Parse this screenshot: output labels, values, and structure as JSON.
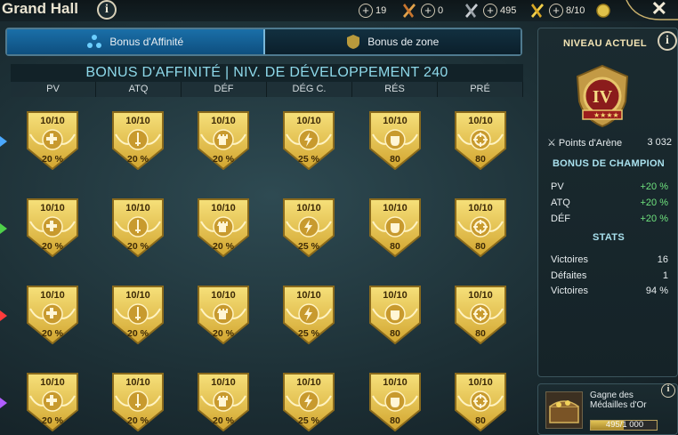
{
  "header": {
    "title": "Grand Hall",
    "resources": [
      {
        "value": "19",
        "icon": "arena-token-icon"
      },
      {
        "value": "0",
        "icon": "sword-token-icon"
      },
      {
        "value": "495",
        "icon": "gold-medal-icon"
      },
      {
        "value": "8/10",
        "icon": "gold-coin-icon"
      }
    ]
  },
  "tabs": [
    {
      "label": "Bonus d'Affinité",
      "active": true
    },
    {
      "label": "Bonus de zone",
      "active": false
    }
  ],
  "main": {
    "heading": "BONUS D'AFFINITÉ | NIV. DE DÉVELOPPEMENT 240",
    "columns": [
      "PV",
      "ATQ",
      "DÉF",
      "DÉG C.",
      "RÉS",
      "PRÉ"
    ],
    "affinities": [
      "magic",
      "force",
      "spirit",
      "void"
    ],
    "affinity_colors": [
      "#4aa8ff",
      "#4fd14a",
      "#ff3b3b",
      "#b05cff"
    ],
    "level_text": "10/10",
    "values": [
      "20 %",
      "20 %",
      "20 %",
      "25 %",
      "80",
      "80"
    ],
    "icons": [
      "health-cross-icon",
      "sword-icon",
      "tower-icon",
      "lightning-icon",
      "fist-icon",
      "crosshair-icon"
    ]
  },
  "panel": {
    "title": "NIVEAU ACTUEL",
    "rank": "IV",
    "points_label": "Points d'Arène",
    "points_value": "3 032",
    "champion_bonus_title": "BONUS DE CHAMPION",
    "champion_bonus": [
      {
        "label": "PV",
        "value": "+20 %"
      },
      {
        "label": "ATQ",
        "value": "+20 %"
      },
      {
        "label": "DÉF",
        "value": "+20 %"
      }
    ],
    "stats_title": "STATS",
    "stats": [
      {
        "label": "Victoires",
        "value": "16"
      },
      {
        "label": "Défaites",
        "value": "1"
      },
      {
        "label": "Victoires",
        "value": "94 %"
      }
    ]
  },
  "reward": {
    "label": "Gagne des Médailles d'Or",
    "progress_text": "495/1 000",
    "progress_fraction": 0.495
  }
}
